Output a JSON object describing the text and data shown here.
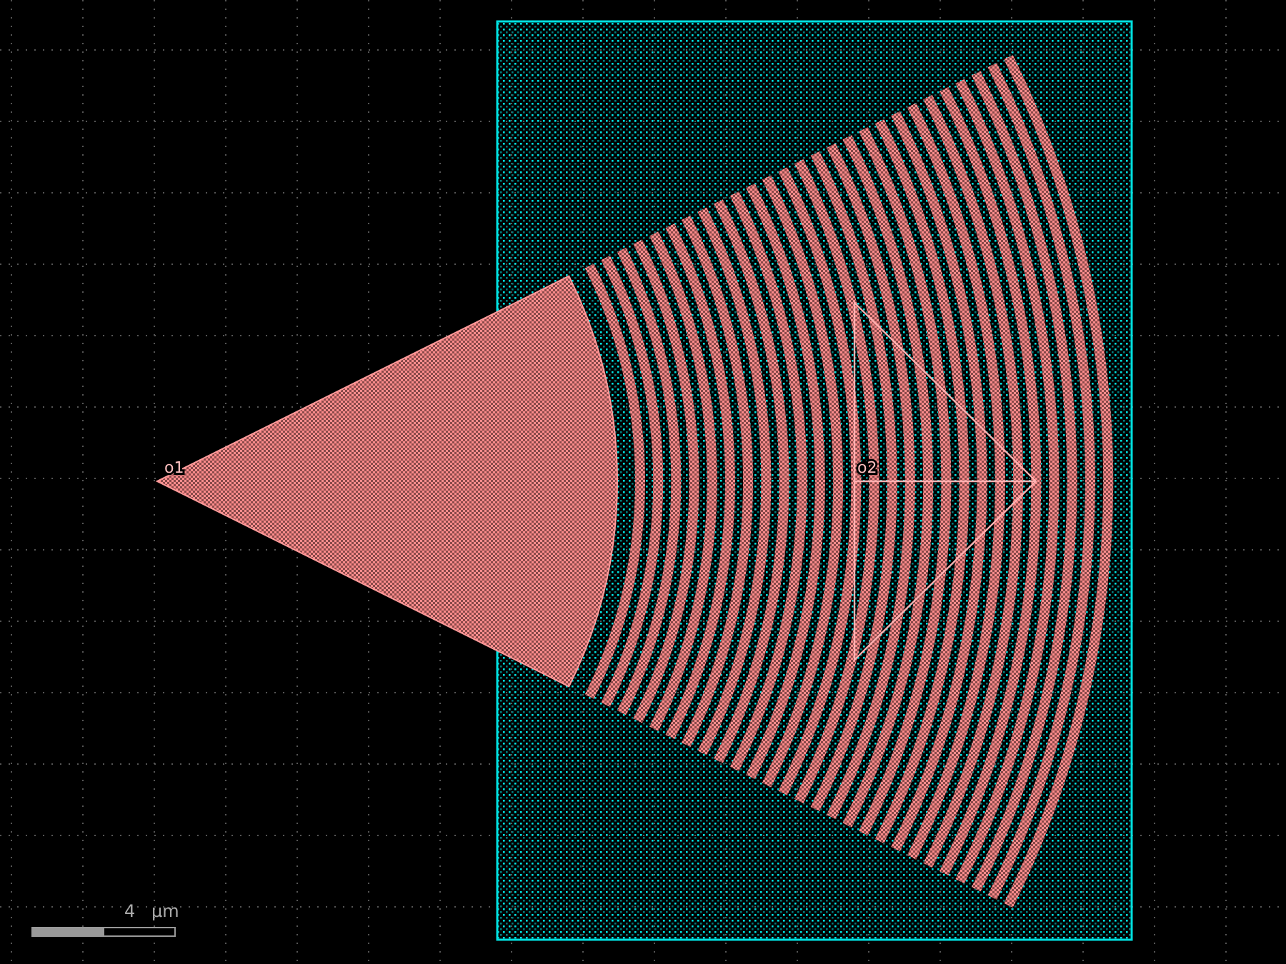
{
  "ports": [
    {
      "label": "o1"
    },
    {
      "label": "o2"
    }
  ],
  "scale_bar": {
    "value": "4",
    "unit": "μm"
  }
}
